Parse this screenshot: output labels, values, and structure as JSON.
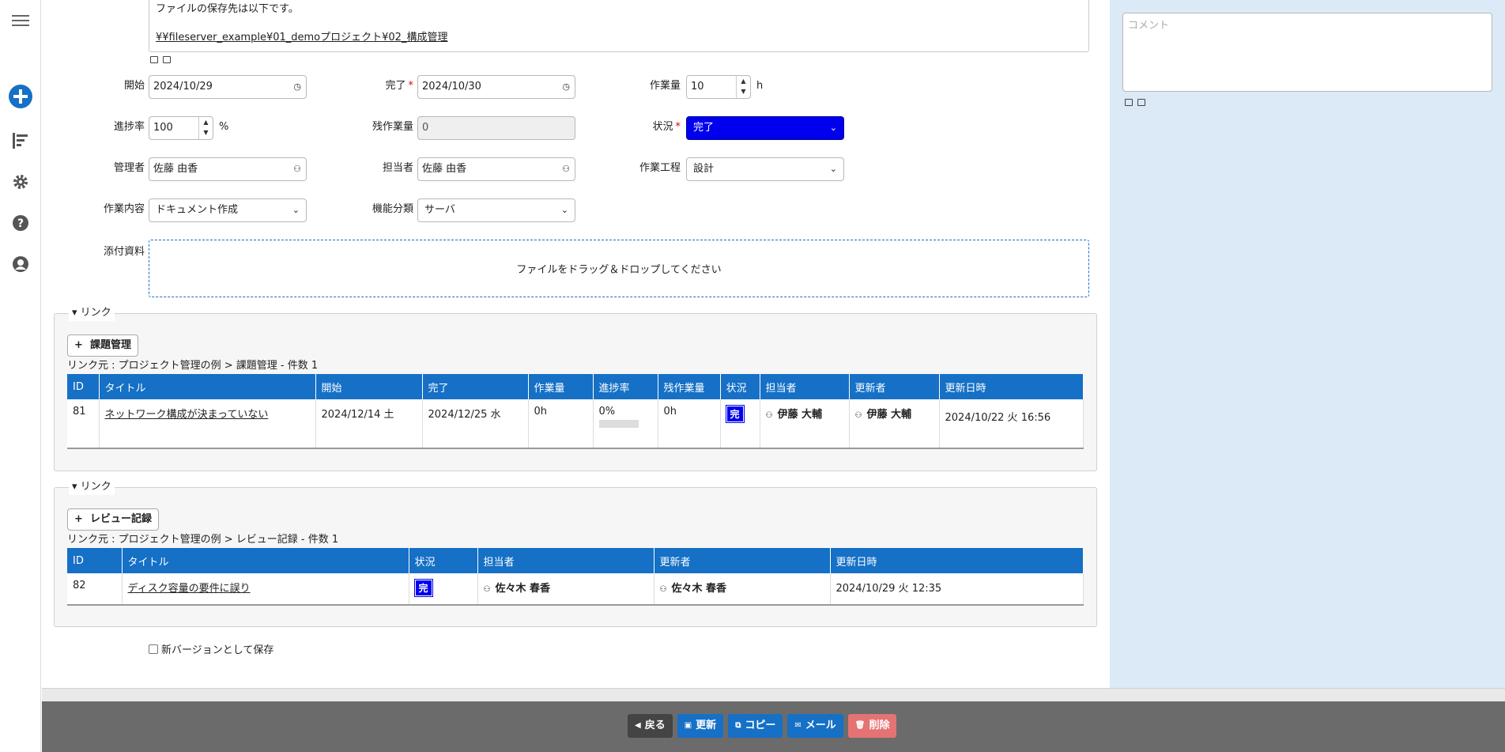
{
  "nav": {
    "icons": [
      "menu-icon",
      "plus-circle-icon",
      "gantt-icon",
      "gear-icon",
      "help-icon",
      "user-icon"
    ],
    "accent": "#1570c6"
  },
  "description": {
    "line1": "ファイルの保存先は以下です。",
    "link": "¥¥fileserver_example¥01_demoプロジェクト¥02_構成管理"
  },
  "form": {
    "start": {
      "label": "開始",
      "value": "2024/10/29"
    },
    "complete": {
      "label": "完了",
      "value": "2024/10/30"
    },
    "work": {
      "label": "作業量",
      "value": "10",
      "unit": "h"
    },
    "progress": {
      "label": "進捗率",
      "value": "100",
      "unit": "%"
    },
    "remaining": {
      "label": "残作業量",
      "value": "0"
    },
    "status": {
      "label": "状況",
      "value": "完了"
    },
    "manager": {
      "label": "管理者",
      "value": "佐藤 由香"
    },
    "assignee": {
      "label": "担当者",
      "value": "佐藤 由香"
    },
    "process": {
      "label": "作業工程",
      "value": "設計"
    },
    "content": {
      "label": "作業内容",
      "value": "ドキュメント作成"
    },
    "category": {
      "label": "機能分類",
      "value": "サーバ"
    },
    "attach": {
      "label": "添付資料",
      "drop_text": "ファイルをドラッグ＆ドロップしてください"
    }
  },
  "link1": {
    "legend": "リンク",
    "add_label": "課題管理",
    "source": "リンク元 : プロジェクト管理の例 > 課題管理 - 件数 1",
    "columns": [
      "ID",
      "タイトル",
      "開始",
      "完了",
      "作業量",
      "進捗率",
      "残作業量",
      "状況",
      "担当者",
      "更新者",
      "更新日時"
    ],
    "row": {
      "id": "81",
      "title": "ネットワーク構成が決まっていない",
      "start": "2024/12/14 土",
      "complete": "2024/12/25 水",
      "work": "0h",
      "progress": "0%",
      "progress_fraction": 0,
      "remaining": "0h",
      "status": "完",
      "assignee": "伊藤 大輔",
      "updater": "伊藤 大輔",
      "updated": "2024/10/22 火 16:56"
    }
  },
  "link2": {
    "legend": "リンク",
    "add_label": "レビュー記録",
    "source": "リンク元 : プロジェクト管理の例 > レビュー記録 - 件数 1",
    "columns": [
      "ID",
      "タイトル",
      "状況",
      "担当者",
      "更新者",
      "更新日時"
    ],
    "row": {
      "id": "82",
      "title": "ディスク容量の要件に誤り",
      "status": "完",
      "assignee": "佐々木 春香",
      "updater": "佐々木 春香",
      "updated": "2024/10/29 火 12:35"
    }
  },
  "save_new_version": "新バージョンとして保存",
  "comment_placeholder": "コメント",
  "footer": {
    "back": "戻る",
    "update": "更新",
    "copy": "コピー",
    "mail": "メール",
    "delete": "削除",
    "colors": {
      "back": "#444444",
      "primary": "#1570c6",
      "delete": "#e57373"
    }
  }
}
